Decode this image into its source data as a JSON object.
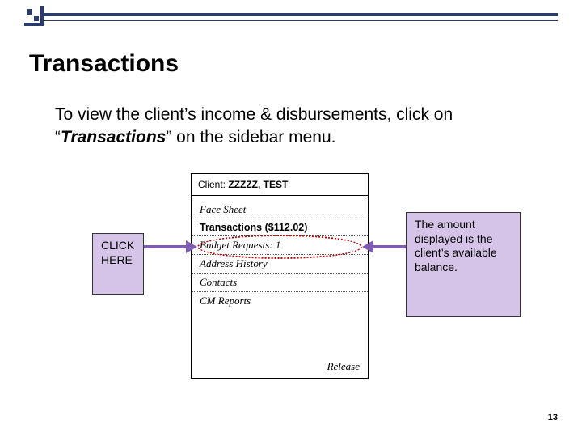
{
  "title": "Transactions",
  "intro": {
    "before": "To view the client’s income & disbursements, click on “",
    "keyword": "Transactions",
    "after": "” on the sidebar menu."
  },
  "panel": {
    "client_label": "Client:",
    "client_value": "ZZZZZ, TEST",
    "menu": {
      "items": [
        {
          "label": "Face Sheet"
        },
        {
          "label": "Transactions ($112.02)",
          "selected": true
        },
        {
          "label": "Budget Requests: 1"
        },
        {
          "label": "Address History"
        },
        {
          "label": "Contacts"
        },
        {
          "label": "CM Reports"
        }
      ]
    },
    "release": "Release"
  },
  "callouts": {
    "left": "CLICK HERE",
    "right": "The amount displayed is the client’s available balance."
  },
  "page_number": "13"
}
